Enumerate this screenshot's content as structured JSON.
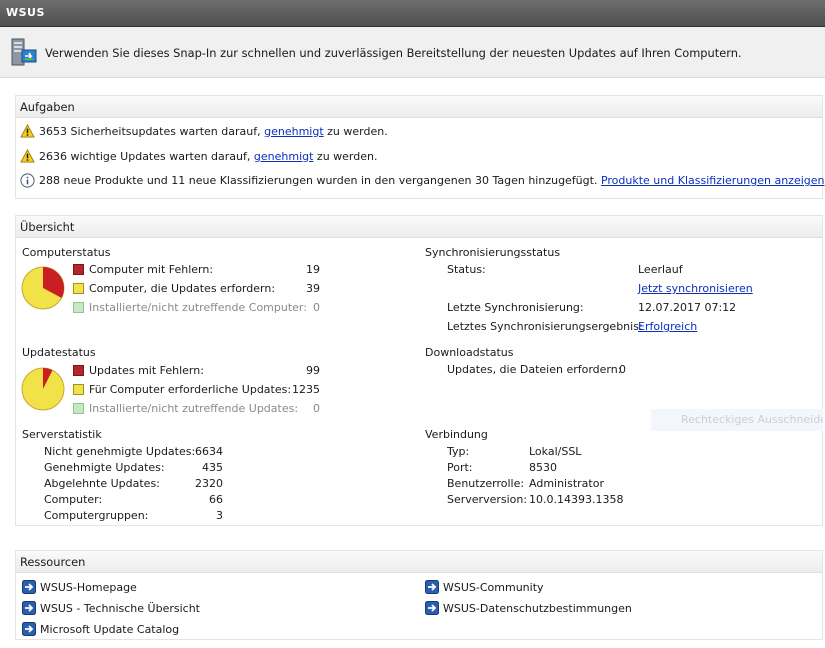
{
  "window": {
    "title": "WSUS"
  },
  "banner": {
    "text": "Verwenden Sie dieses Snap-In zur schnellen und zuverlässigen Bereitstellung der neuesten Updates auf Ihren Computern."
  },
  "tasks": {
    "title": "Aufgaben",
    "items": [
      {
        "pre": "3653 Sicherheitsupdates warten darauf, ",
        "link": "genehmigt",
        "post": " zu werden."
      },
      {
        "pre": "2636 wichtige Updates warten darauf, ",
        "link": "genehmigt",
        "post": " zu werden."
      },
      {
        "pre": "288 neue Produkte und 11 neue Klassifizierungen wurden in den vergangenen 30 Tagen hinzugefügt. ",
        "link": "Produkte und Klassifizierungen anzeigen",
        "post": ""
      }
    ]
  },
  "overview": {
    "title": "Übersicht",
    "computer_status": {
      "title": "Computerstatus",
      "rows": [
        {
          "label": "Computer mit Fehlern:",
          "value": "19"
        },
        {
          "label": "Computer, die Updates erfordern:",
          "value": "39"
        },
        {
          "label": "Installierte/nicht zutreffende Computer:",
          "value": "0"
        }
      ]
    },
    "update_status": {
      "title": "Updatestatus",
      "rows": [
        {
          "label": "Updates mit Fehlern:",
          "value": "99"
        },
        {
          "label": "Für Computer erforderliche Updates:",
          "value": "1235"
        },
        {
          "label": "Installierte/nicht zutreffende Updates:",
          "value": "0"
        }
      ]
    },
    "server_stats": {
      "title": "Serverstatistik",
      "rows": [
        {
          "label": "Nicht genehmigte Updates:",
          "value": "6634"
        },
        {
          "label": "Genehmigte Updates:",
          "value": "435"
        },
        {
          "label": "Abgelehnte Updates:",
          "value": "2320"
        },
        {
          "label": "Computer:",
          "value": "66"
        },
        {
          "label": "Computergruppen:",
          "value": "3"
        }
      ]
    },
    "sync_status": {
      "title": "Synchronisierungsstatus",
      "status_label": "Status:",
      "status_value": "Leerlauf",
      "sync_now": "Jetzt synchronisieren",
      "last_sync_label": "Letzte Synchronisierung:",
      "last_sync_value": "12.07.2017 07:12",
      "last_result_label": "Letztes Synchronisierungsergebnis:",
      "last_result_value": "Erfolgreich"
    },
    "download_status": {
      "title": "Downloadstatus",
      "label": "Updates, die Dateien erfordern:",
      "value": "0"
    },
    "connection": {
      "title": "Verbindung",
      "rows": [
        {
          "label": "Typ:",
          "value": "Lokal/SSL"
        },
        {
          "label": "Port:",
          "value": "8530"
        },
        {
          "label": "Benutzerrolle:",
          "value": "Administrator"
        },
        {
          "label": "Serverversion:",
          "value": "10.0.14393.1358"
        }
      ]
    },
    "ghost_text": "Rechteckiges Ausschneiden"
  },
  "resources": {
    "title": "Ressourcen",
    "links": [
      "WSUS-Homepage",
      "WSUS - Technische Übersicht",
      "Microsoft Update Catalog",
      "WSUS-Community",
      "WSUS-Datenschutzbestimmungen"
    ]
  },
  "colors": {
    "error": "#b3262b",
    "needed": "#f1e24a",
    "installed": "#c6e8c2",
    "link": "#0b2fbf"
  }
}
